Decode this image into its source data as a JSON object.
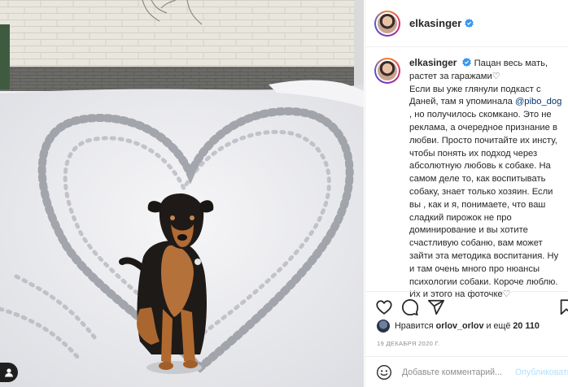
{
  "post": {
    "username": "elkasinger",
    "verified": true,
    "caption_lines": [
      "Пацан весь мать,",
      "растет за гаражами♡",
      "Если вы уже глянули подкаст с",
      "Даней, там я упоминала",
      ", но получилось скомкано. Это не",
      "реклама, а очередное признание в",
      "любви. Просто почитайте их инсту,",
      "чтобы понять их подход через",
      "абсолютную любовь к собаке. На",
      "самом деле то, как воспитывать",
      "собаку, знает только хозяин. Если",
      "вы , как и я, понимаете, что ваш",
      "сладкий пирожок не про",
      "доминирование и вы хотите",
      "счастливую собаню, вам может",
      "зайти эта методика воспитания. Ну",
      "и там очень много про нюансы",
      "психологии собаки. Короче люблю.",
      "Их и этого на фоточке♡"
    ],
    "mention": "@pibo_dog",
    "likes_prefix": "Нравится",
    "likes_user": "orlov_orlov",
    "likes_middle": "и ещё",
    "likes_count": "20 110",
    "date": "19 ДЕКАБРЯ 2020 Г.",
    "comment_placeholder": "Добавьте комментарий...",
    "post_button": "Опубликовать"
  },
  "icons": {
    "like": "heart-outline-icon",
    "comment": "comment-bubble-icon",
    "share": "paper-plane-icon",
    "save": "bookmark-icon",
    "verified": "verified-badge-icon",
    "emoji": "smiley-icon",
    "user": "user-silhouette-icon"
  },
  "colors": {
    "verified_blue": "#3897f0",
    "link_blue": "#00376b",
    "post_button_disabled": "#b2dffc"
  }
}
